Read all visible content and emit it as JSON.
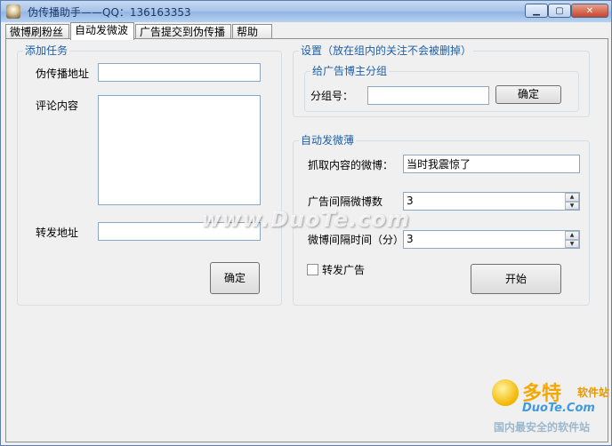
{
  "window": {
    "title": "伪传播助手——QQ：136163353",
    "minimize": "▁",
    "maximize": "▢",
    "close": "✕"
  },
  "tabs": [
    {
      "label": "微博刷粉丝"
    },
    {
      "label": "自动发微波"
    },
    {
      "label": "广告提交到伪传播"
    },
    {
      "label": "帮助"
    }
  ],
  "add_task": {
    "legend": "添加任务",
    "spread_url_label": "伪传播地址",
    "spread_url_value": "",
    "comment_label": "评论内容",
    "comment_value": "",
    "forward_url_label": "转发地址",
    "forward_url_value": "",
    "confirm_label": "确定"
  },
  "settings": {
    "legend": "设置（放在组内的关注不会被删掉）",
    "sub_legend": "给广告博主分组",
    "group_label": "分组号：",
    "group_value": "",
    "confirm_label": "确定"
  },
  "auto_post": {
    "legend": "自动发微薄",
    "fetch_label": "抓取内容的微博：",
    "fetch_value": "当时我震惊了",
    "ad_interval_label": "广告间隔微博数",
    "ad_interval_value": "3",
    "post_interval_label": "微博间隔时间（分）",
    "post_interval_value": "3",
    "forward_ad_label": "转发广告",
    "forward_ad_checked": false,
    "start_label": "开始"
  },
  "watermark": {
    "text": "www.DuoTe.com",
    "logo_big": "多特",
    "logo_small": "软件站",
    "logo_domain": "DuoTe.Com",
    "logo_slogan": "国内最安全的软件站"
  },
  "icons": {
    "app": "app-icon",
    "spin_up": "▲",
    "spin_down": "▼"
  }
}
